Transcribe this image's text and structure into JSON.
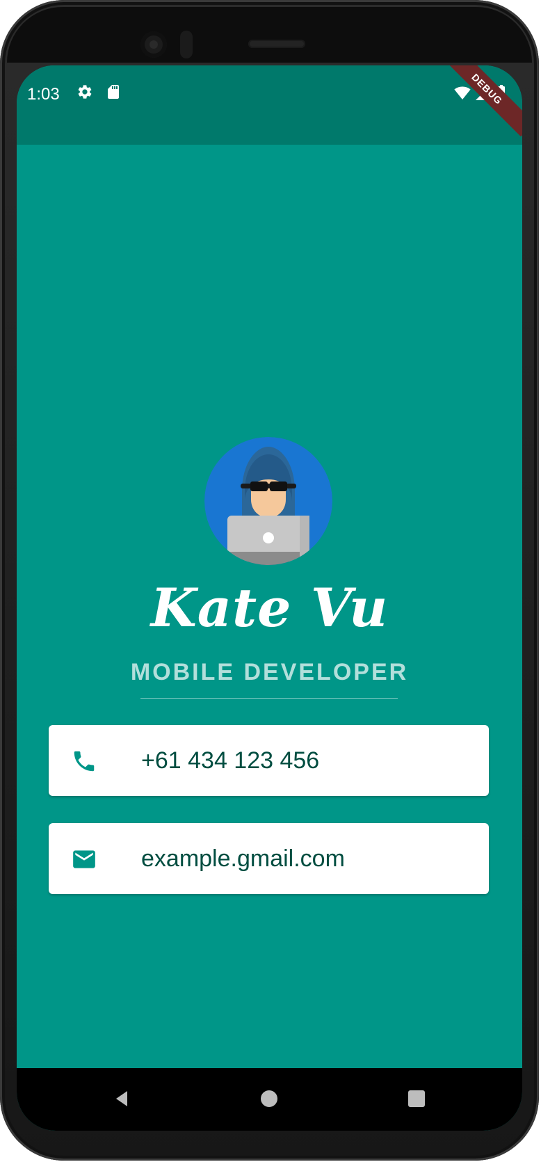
{
  "status_bar": {
    "time": "1:03",
    "debug_label": "DEBUG",
    "icons": [
      "gear-icon",
      "sd-card-icon",
      "wifi-icon",
      "signal-icon",
      "battery-icon"
    ]
  },
  "profile": {
    "name": "Kate Vu",
    "title": "MOBILE DEVELOPER",
    "avatar": "hacker-avatar-icon"
  },
  "contacts": [
    {
      "icon": "phone-icon",
      "value": "+61 434 123 456"
    },
    {
      "icon": "email-icon",
      "value": "example.gmail.com"
    }
  ],
  "nav": {
    "items": [
      "back-icon",
      "home-icon",
      "recents-icon"
    ]
  },
  "colors": {
    "primary": "#009688",
    "primary_dark": "#00796b",
    "card_text": "#004d40",
    "subtitle": "#b2dfdb",
    "debug_ribbon": "#6d2727"
  }
}
